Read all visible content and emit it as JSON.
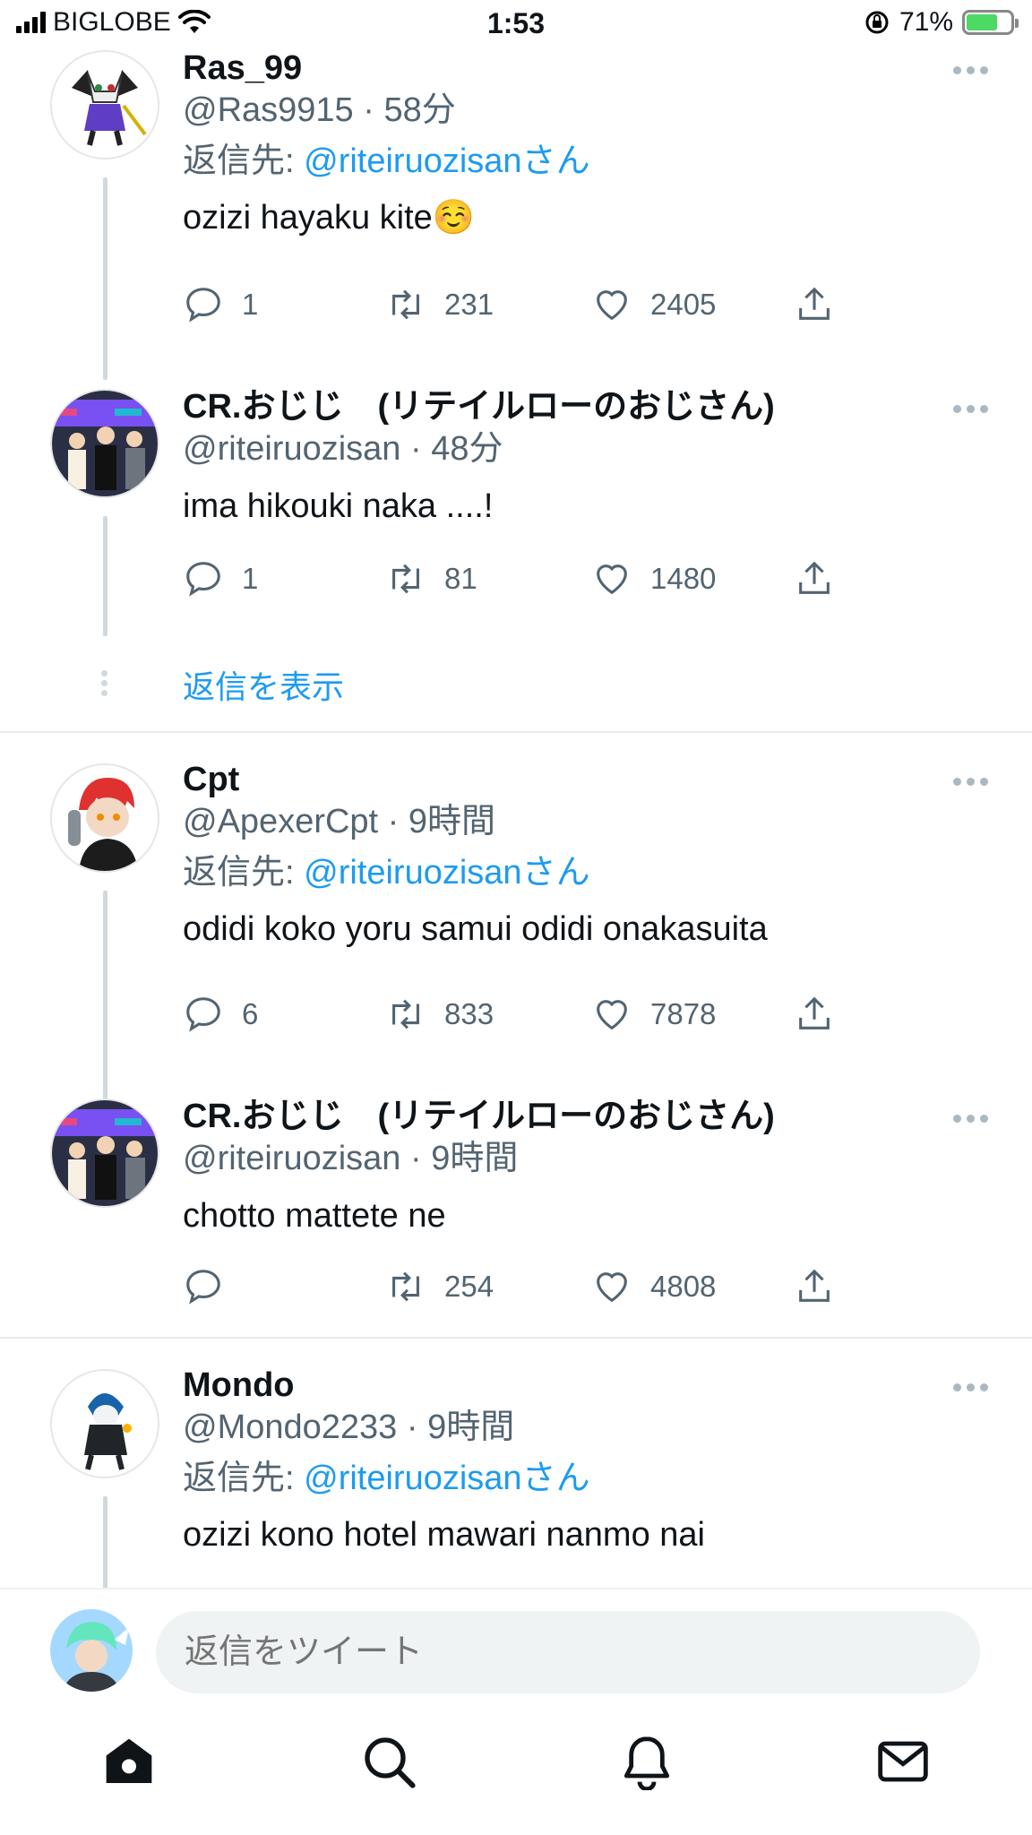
{
  "status_bar": {
    "carrier": "BIGLOBE",
    "time": "1:53",
    "battery": "71%"
  },
  "tweets": [
    {
      "name": "Ras_99",
      "handle": "@Ras9915",
      "time": "58分",
      "reply_prefix": "返信先:",
      "reply_user": "@riteiruozisan",
      "reply_suffix": "さん",
      "text": "ozizi hayaku kite☺️",
      "replies": "1",
      "retweets": "231",
      "likes": "2405"
    },
    {
      "name": "CR.おじじ　(リテイルローのおじさん)",
      "handle": "@riteiruozisan",
      "time": "48分",
      "text": "ima hikouki naka ....!",
      "replies": "1",
      "retweets": "81",
      "likes": "1480"
    },
    {
      "name": "Cpt",
      "handle": "@ApexerCpt",
      "time": "9時間",
      "reply_prefix": "返信先:",
      "reply_user": "@riteiruozisan",
      "reply_suffix": "さん",
      "text": "odidi koko yoru samui odidi onakasuita",
      "replies": "6",
      "retweets": "833",
      "likes": "7878"
    },
    {
      "name": "CR.おじじ　(リテイルローのおじさん)",
      "handle": "@riteiruozisan",
      "time": "9時間",
      "text": "chotto mattete ne",
      "replies": "",
      "retweets": "254",
      "likes": "4808"
    },
    {
      "name": "Mondo",
      "handle": "@Mondo2233",
      "time": "9時間",
      "reply_prefix": "返信先:",
      "reply_user": "@riteiruozisan",
      "reply_suffix": "さん",
      "text": "ozizi kono hotel mawari nanmo nai"
    }
  ],
  "show_replies": "返信を表示",
  "composer": {
    "placeholder": "返信をツイート"
  },
  "tabs": [
    "home-icon",
    "search-icon",
    "notifications-icon",
    "messages-icon"
  ],
  "colors": {
    "accent": "#1d9bf0",
    "secondary_text": "#536471",
    "battery": "#4cd964"
  }
}
